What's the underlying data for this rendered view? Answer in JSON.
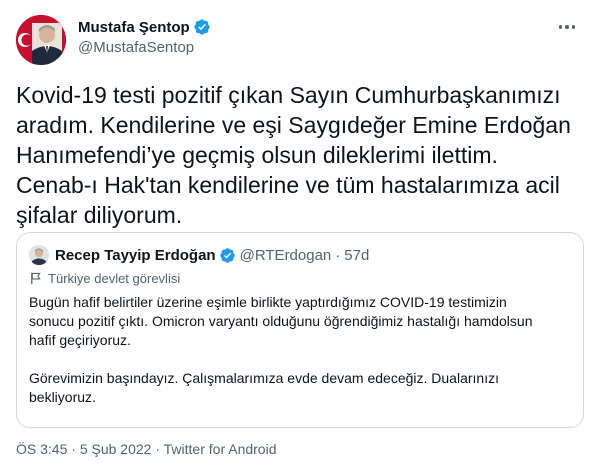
{
  "author": {
    "name": "Mustafa Şentop",
    "handle": "@MustafaSentop",
    "verified_color": "#1d9bf0"
  },
  "tweet": {
    "text": "Kovid-19 testi pozitif çıkan Sayın Cumhurbaşkanımızı\naradım. Kendilerine ve eşi Saygıdeğer Emine Erdoğan\nHanımefendi’ye geçmiş olsun dileklerimi ilettim.\nCenab-ı Hak'tan kendilerine ve tüm hastalarımıza acil\nşifalar diliyorum."
  },
  "quoted": {
    "name": "Recep Tayyip Erdoğan",
    "handle": "@RTErdogan",
    "separator": "·",
    "time": "57d",
    "label": "Türkiye devlet görevlisi",
    "text": "Bugün hafif belirtiler üzerine eşimle birlikte yaptırdığımız COVID-19 testimizin\nsonucu pozitif çıktı. Omicron varyantı olduğunu öğrendiğimiz hastalığı hamdolsun\nhafif geçiriyoruz.\n\nGörevimizin başındayız. Çalışmalarımıza evde devam edeceğiz. Dualarınızı\nbekliyoruz."
  },
  "meta": {
    "time": "ÖS 3:45",
    "separator1": " · ",
    "date": "5 Şub 2022",
    "separator2": " · ",
    "source": "Twitter for Android"
  },
  "icons": {
    "more": "more-horizontal-icon",
    "verified": "verified-badge-icon",
    "label": "flag-icon"
  }
}
